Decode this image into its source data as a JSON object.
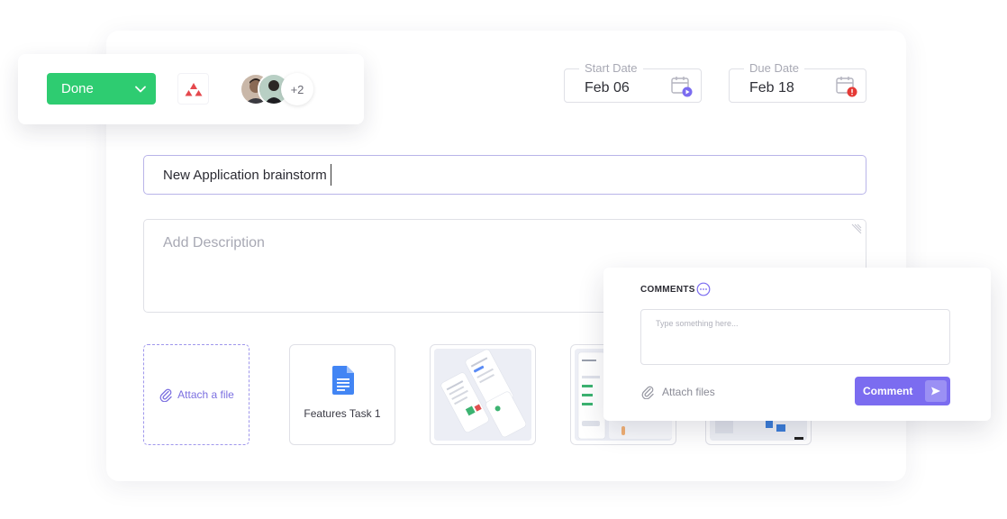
{
  "status": {
    "label": "Done",
    "color": "#2ecc71"
  },
  "assignees": {
    "extra_count": "+2"
  },
  "dates": {
    "start": {
      "label": "Start Date",
      "value": "Feb 06"
    },
    "due": {
      "label": "Due Date",
      "value": "Feb 18"
    }
  },
  "task": {
    "title": "New Application brainstorm",
    "description_placeholder": "Add Description"
  },
  "attachments": {
    "attach_label": "Attach a file",
    "files": [
      {
        "name": "Features Task 1",
        "icon": "google-doc-icon"
      }
    ]
  },
  "comments": {
    "title": "COMMENTS",
    "input_placeholder": "Type something here...",
    "attach_files_label": "Attach files",
    "submit_label": "Comment"
  },
  "colors": {
    "accent": "#7b6cf0",
    "success": "#2ecc71",
    "danger": "#e53935",
    "priority": "#e5484d"
  }
}
